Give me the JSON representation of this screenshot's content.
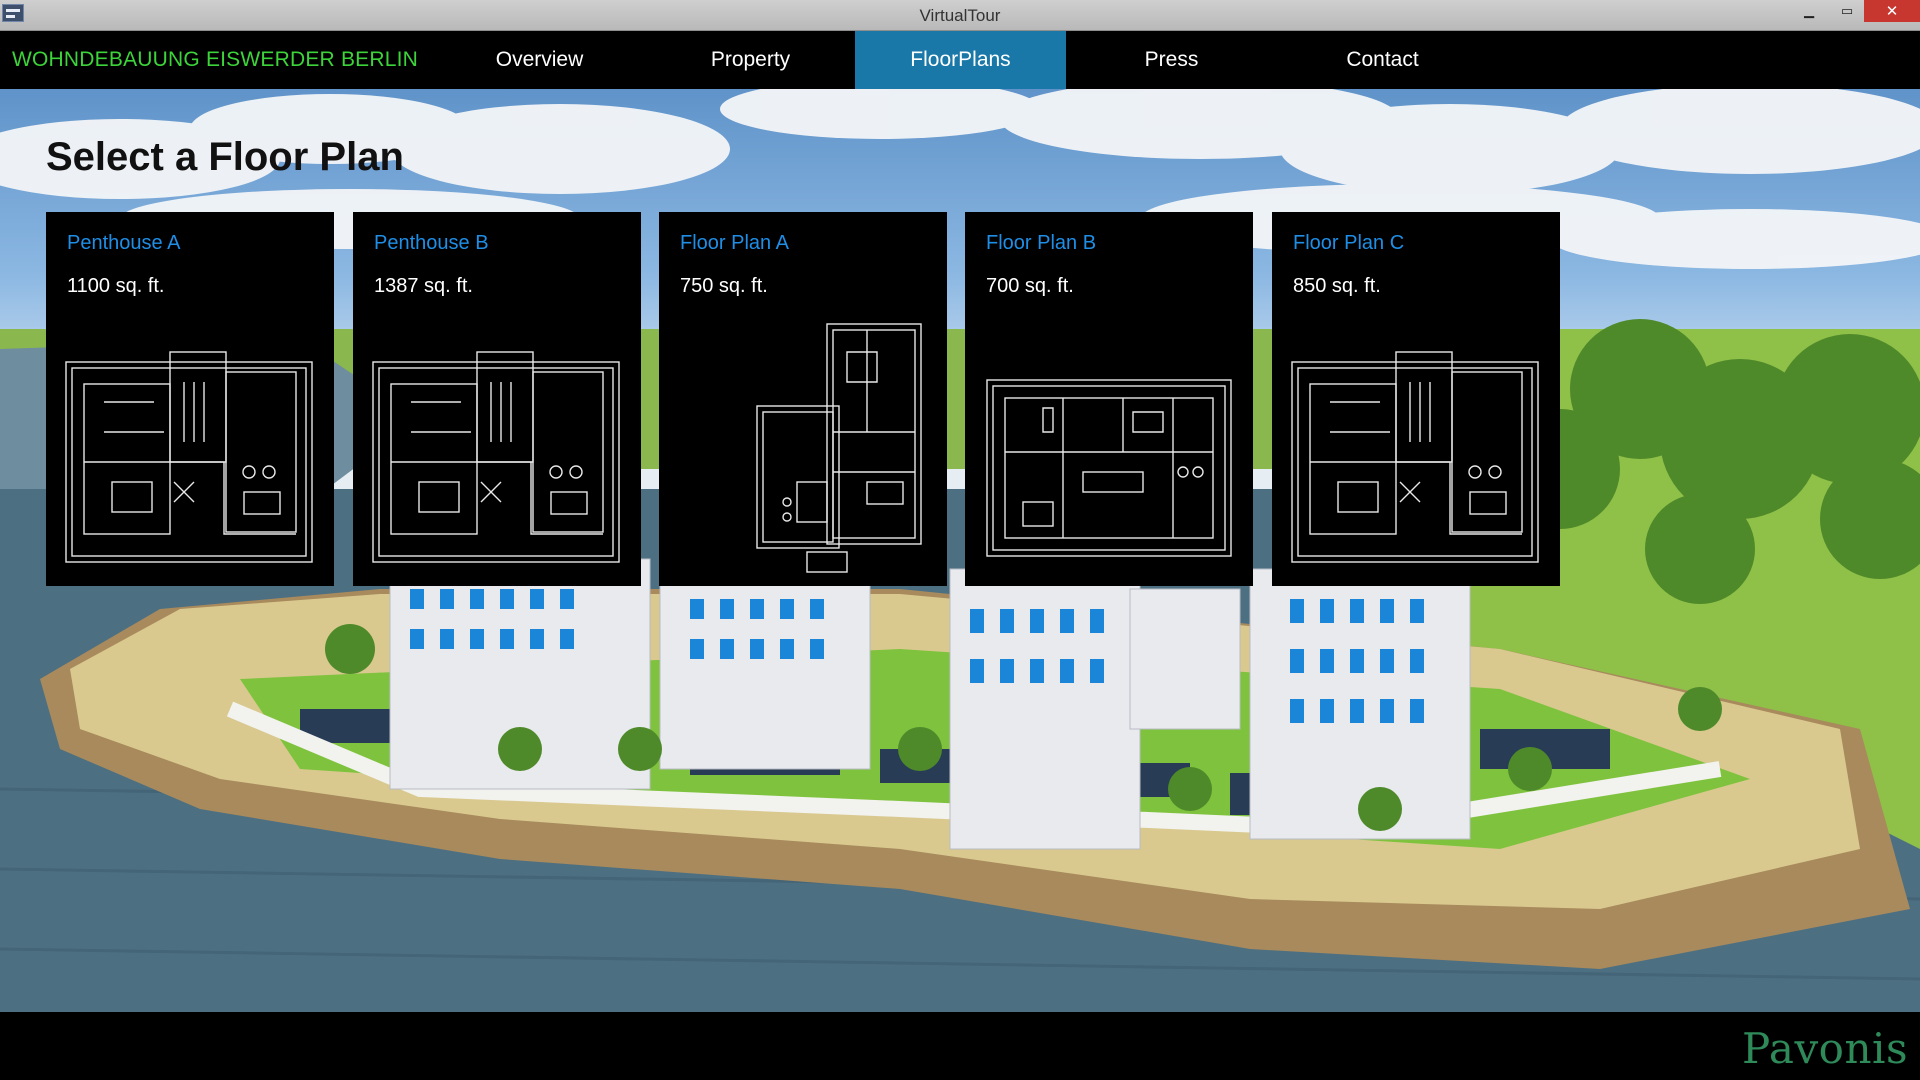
{
  "window": {
    "title": "VirtualTour",
    "minimize_glyph": "▁",
    "maximize_glyph": "▭",
    "close_glyph": "✕"
  },
  "nav": {
    "brand": "WOHNDEBAUUNG EISWERDER BERLIN",
    "brand_color": "#3cd43a",
    "active_color": "#1a78a8",
    "items": [
      {
        "label": "Overview",
        "active": false
      },
      {
        "label": "Property",
        "active": false
      },
      {
        "label": "FloorPlans",
        "active": true
      },
      {
        "label": "Press",
        "active": false
      },
      {
        "label": "Contact",
        "active": false
      }
    ]
  },
  "main": {
    "heading": "Select a Floor Plan",
    "cards": [
      {
        "name": "Penthouse A",
        "area": "1100 sq. ft.",
        "plan_icon": "floor-plan-layout-1"
      },
      {
        "name": "Penthouse B",
        "area": "1387 sq. ft.",
        "plan_icon": "floor-plan-layout-1"
      },
      {
        "name": "Floor Plan A",
        "area": "750 sq. ft.",
        "plan_icon": "floor-plan-layout-2"
      },
      {
        "name": "Floor Plan B",
        "area": "700 sq. ft.",
        "plan_icon": "floor-plan-layout-3"
      },
      {
        "name": "Floor Plan C",
        "area": "850 sq. ft.",
        "plan_icon": "floor-plan-layout-1"
      }
    ],
    "card_title_color": "#1f8ee6"
  },
  "footer": {
    "logo_text": "Pavonis",
    "logo_color": "#2f8a5a"
  }
}
